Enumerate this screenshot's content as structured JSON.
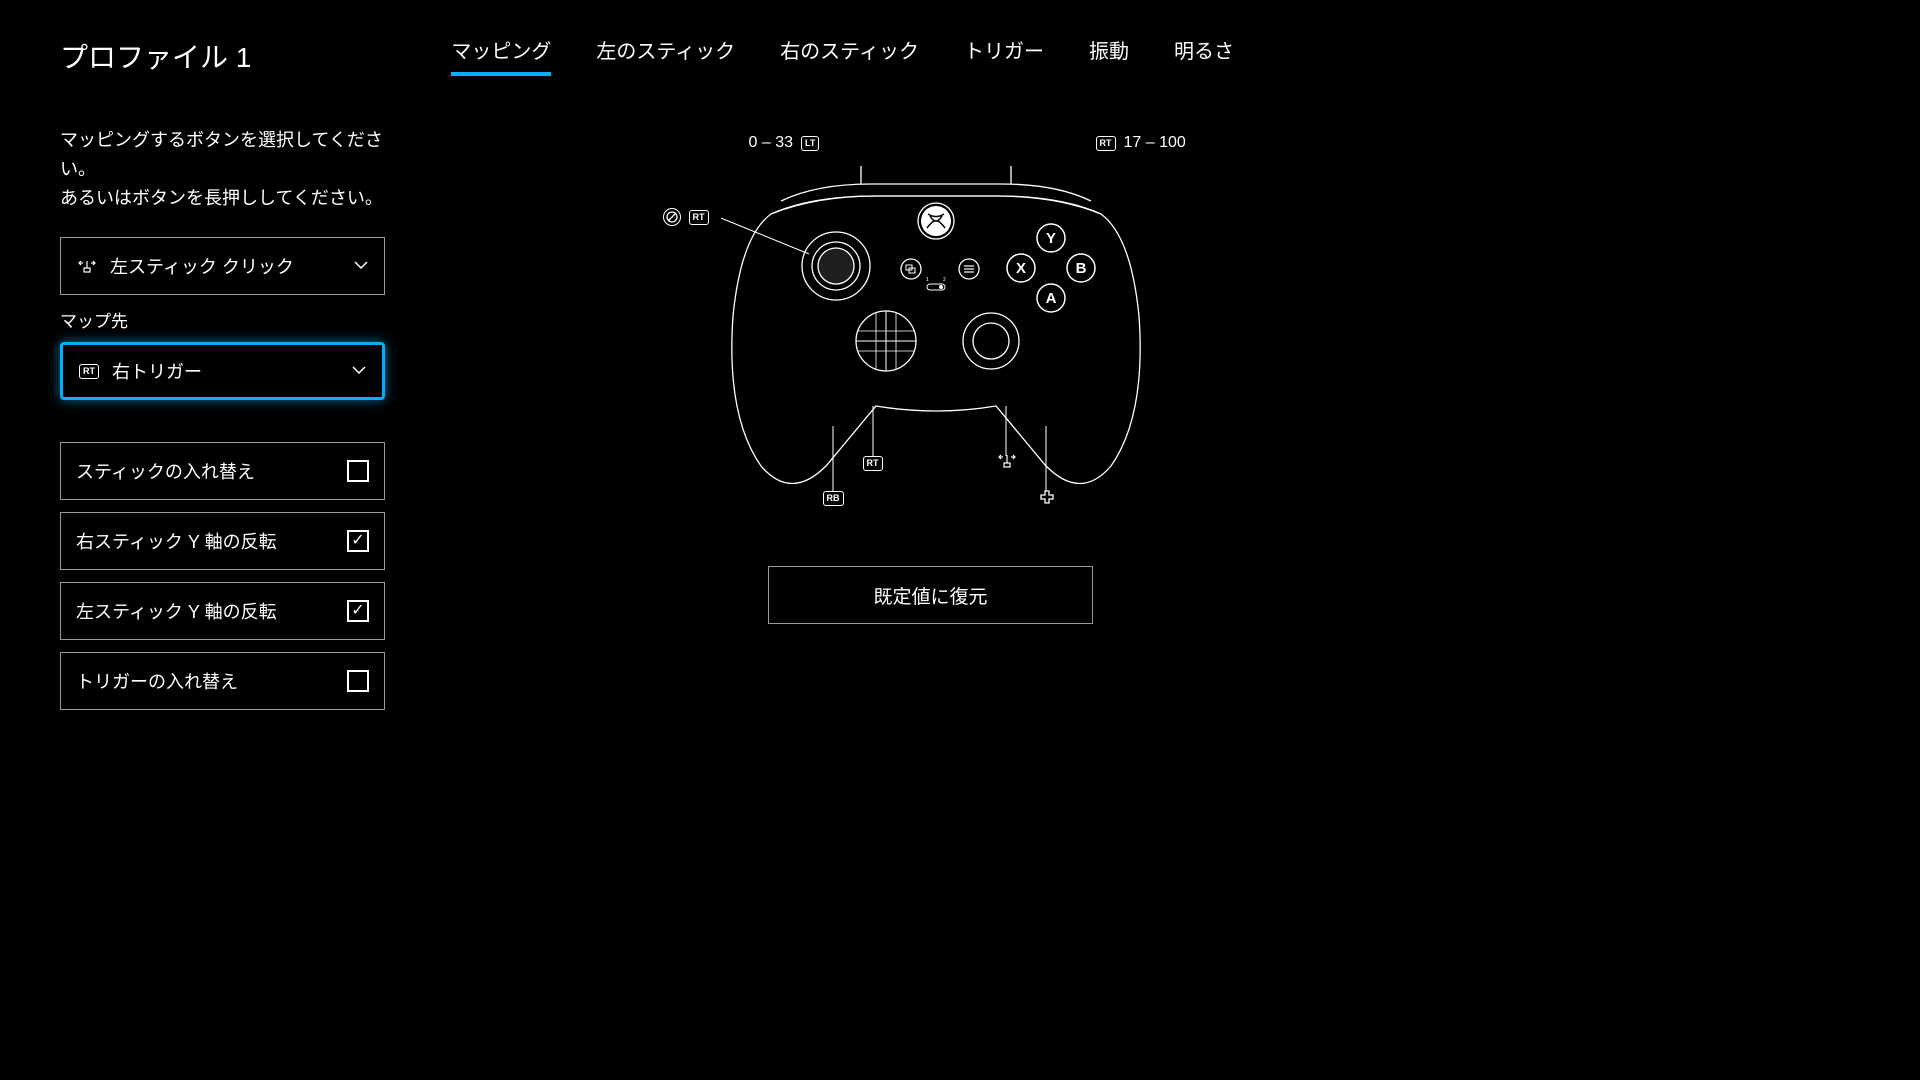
{
  "header": {
    "title": "プロファイル 1",
    "tabs": [
      {
        "label": "マッピング",
        "active": true
      },
      {
        "label": "左のスティック",
        "active": false
      },
      {
        "label": "右のスティック",
        "active": false
      },
      {
        "label": "トリガー",
        "active": false
      },
      {
        "label": "振動",
        "active": false
      },
      {
        "label": "明るさ",
        "active": false
      }
    ]
  },
  "panel": {
    "instructions_line1": "マッピングするボタンを選択してください。",
    "instructions_line2": "あるいはボタンを長押ししてください。",
    "source_select": {
      "icon": "left-stick-click-icon",
      "label": "左スティック クリック"
    },
    "map_to_heading": "マップ先",
    "target_select": {
      "icon": "rt-icon",
      "icon_text": "RT",
      "label": "右トリガー",
      "focused": true
    },
    "checkboxes": [
      {
        "key": "swap-sticks",
        "label": "スティックの入れ替え",
        "checked": false
      },
      {
        "key": "invert-right-y",
        "label": "右スティック Y 軸の反転",
        "checked": true
      },
      {
        "key": "invert-left-y",
        "label": "左スティック Y 軸の反転",
        "checked": true
      },
      {
        "key": "swap-triggers",
        "label": "トリガーの入れ替え",
        "checked": false
      }
    ]
  },
  "diagram": {
    "lt_range": "0 – 33",
    "lt_badge": "LT",
    "rt_range": "17 – 100",
    "rt_badge": "RT",
    "ls_badge": "RT",
    "face_buttons": {
      "a": "A",
      "b": "B",
      "x": "X",
      "y": "Y"
    },
    "paddle_labels": {
      "p1": "RT",
      "p2": "RB"
    }
  },
  "reset_button": "既定値に復元"
}
